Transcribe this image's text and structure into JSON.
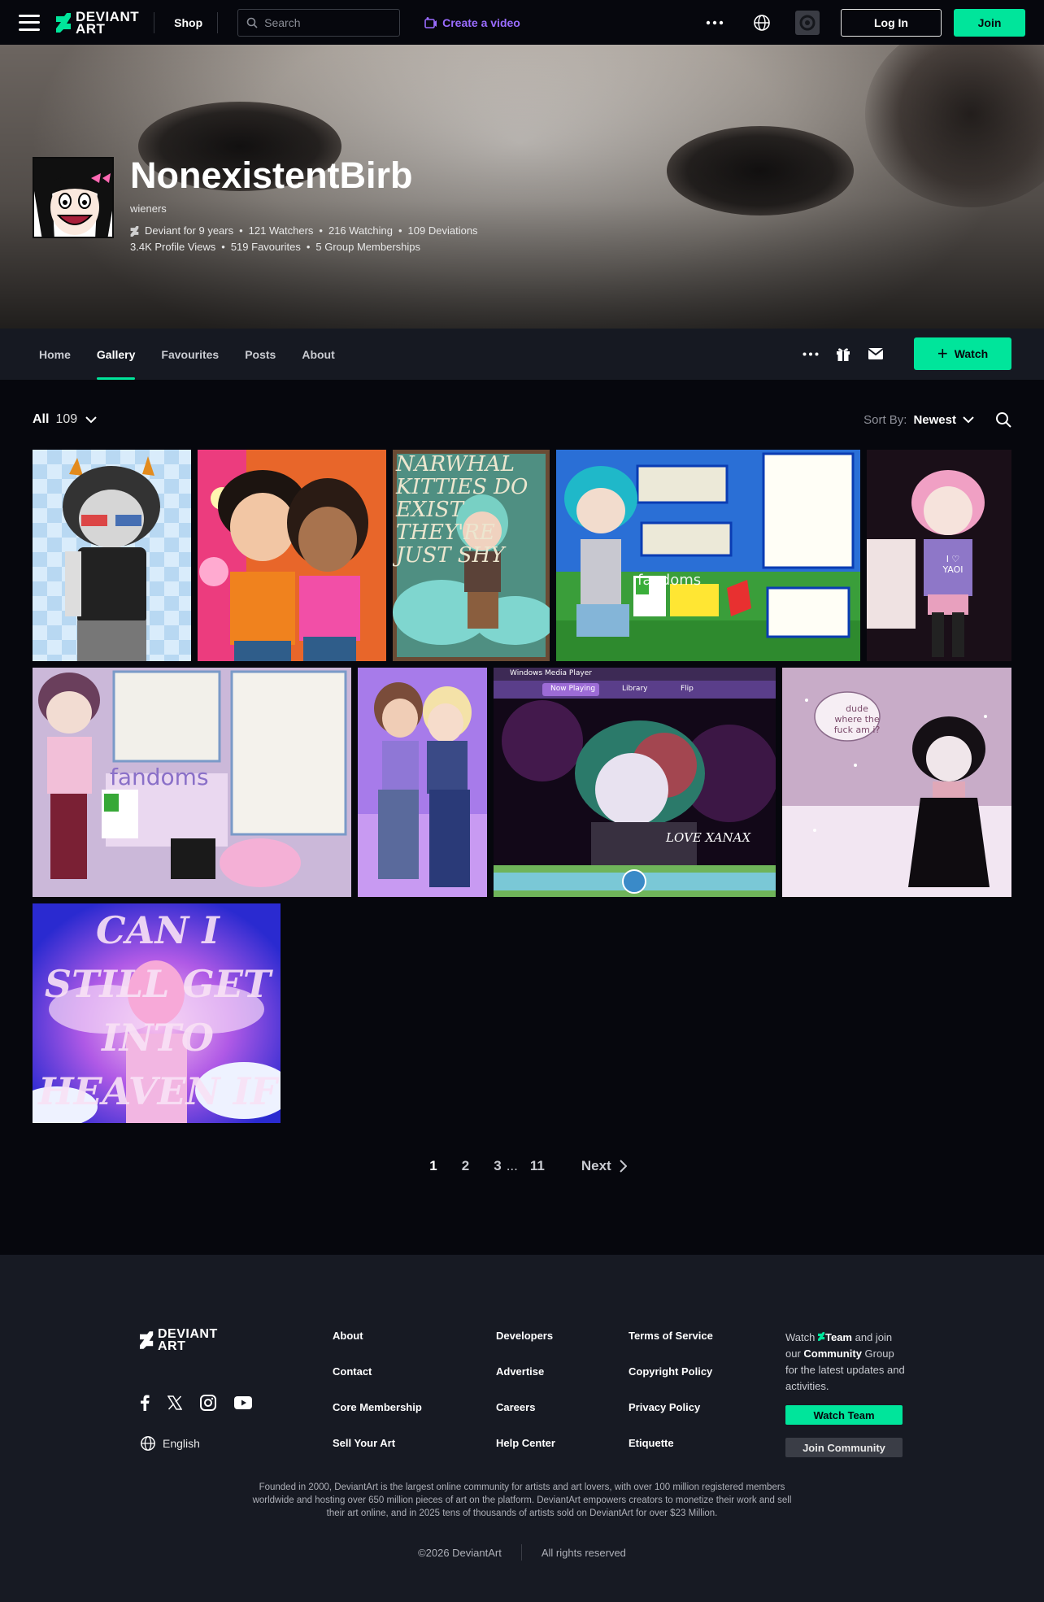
{
  "topbar": {
    "shop_label": "Shop",
    "search_placeholder": "Search",
    "create_label": "Create a video",
    "login_label": "Log In",
    "join_label": "Join",
    "logo_line1": "DEVIANT",
    "logo_line2": "ART"
  },
  "profile": {
    "username": "NonexistentBirb",
    "tagline": "wieners",
    "stats_line1": [
      "Deviant for 9 years",
      "121 Watchers",
      "216 Watching",
      "109 Deviations"
    ],
    "stats_line2": [
      "3.4K Profile Views",
      "519 Favourites",
      "5 Group Memberships"
    ]
  },
  "nav": {
    "tabs": [
      "Home",
      "Gallery",
      "Favourites",
      "Posts",
      "About"
    ],
    "active_tab": "Gallery",
    "watch_label": "Watch"
  },
  "gallery": {
    "filter_label": "All",
    "count": "109",
    "sort_label": "Sort By:",
    "sort_value": "Newest",
    "thumb_texts": {
      "narwhal": "NARWHAL KITTIES DO EXIST THEY'RE JUST SHY",
      "heaven": "CAN I STILL GET INTO HEAVEN IF I KILL MYSELF?",
      "snow": "dude where the fuck am i?",
      "xanax": "LOVE XANAX",
      "wmp_title": "Windows Media Player",
      "wmp_tabs": [
        "Now Playing",
        "Library",
        "Flip"
      ],
      "fandoms": "fandoms",
      "yaoi": "I ♡ YAOI"
    }
  },
  "pagination": {
    "pages": [
      "1",
      "2",
      "3"
    ],
    "ellipsis": "...",
    "last": "11",
    "next_label": "Next"
  },
  "footer": {
    "col1": [
      "About",
      "Contact",
      "Core Membership",
      "Sell Your Art"
    ],
    "col2": [
      "Developers",
      "Advertise",
      "Careers",
      "Help Center"
    ],
    "col3": [
      "Terms of Service",
      "Copyright Policy",
      "Privacy Policy",
      "Etiquette"
    ],
    "language": "English",
    "cta_pre": "Watch",
    "cta_team": "Team",
    "cta_mid": "and join our",
    "cta_comm": "Community",
    "cta_post": "Group for the latest updates and activities.",
    "team_button": "Watch Team",
    "community_button": "Join Community",
    "about_text": "Founded in 2000, DeviantArt is the largest online community for artists and art lovers, with over 100 million registered members worldwide and hosting over 650 million pieces of art on the platform. DeviantArt empowers creators to monetize their work and sell their art online, and in 2025 tens of thousands of artists sold on DeviantArt for over $23 Million.",
    "copyright": "©2026 DeviantArt",
    "rights": "All rights reserved"
  },
  "colors": {
    "accent": "#00e59b",
    "create_purple": "#9a6cff",
    "background": "#06070d",
    "footer_bg": "#171a23"
  }
}
